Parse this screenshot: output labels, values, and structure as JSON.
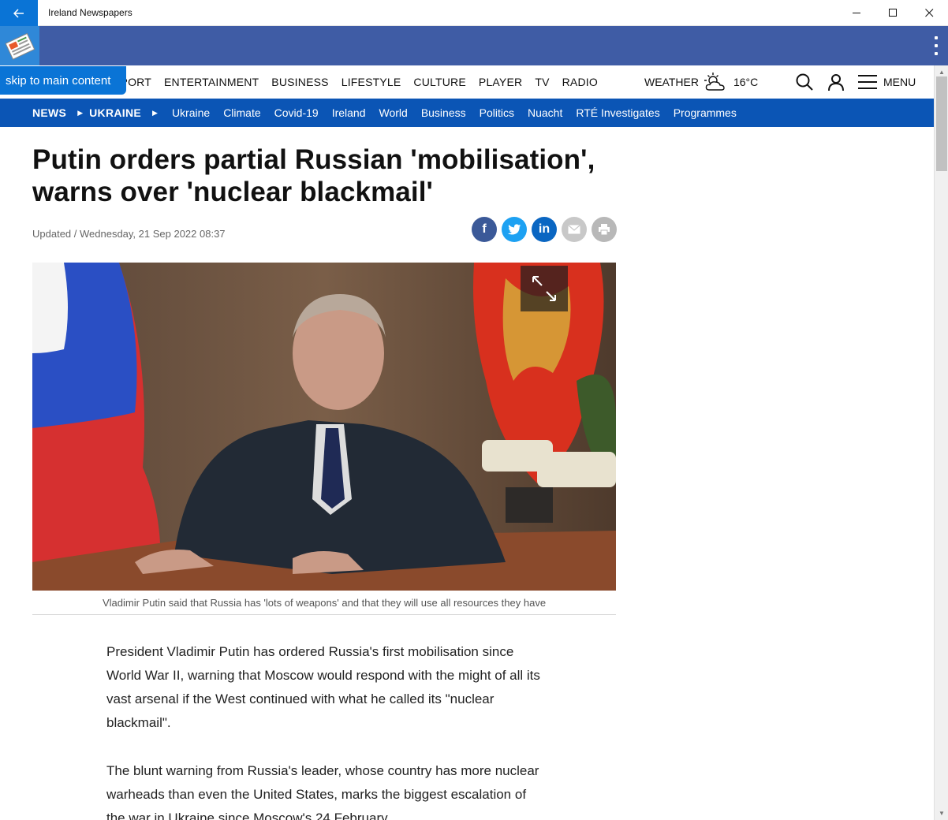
{
  "window": {
    "app_title": "Ireland Newspapers",
    "back_icon": "back-arrow-icon",
    "controls": [
      "minimize-icon",
      "maximize-icon",
      "close-icon"
    ]
  },
  "appbar": {
    "color": "#3f5ca5",
    "logo_icon": "newspaper-icon",
    "overflow_icon": "more-vertical-icon"
  },
  "skip_link": "skip to main content",
  "main_nav": {
    "items": [
      "SPORT",
      "ENTERTAINMENT",
      "BUSINESS",
      "LIFESTYLE",
      "CULTURE",
      "PLAYER",
      "TV",
      "RADIO"
    ],
    "weather_label": "WEATHER",
    "weather_icon": "partly-cloudy-icon",
    "temperature": "16°C",
    "menu_label": "MENU"
  },
  "sub_nav": {
    "color": "#0b55b5",
    "section": "NEWS",
    "topic": "UKRAINE",
    "items": [
      "Ukraine",
      "Climate",
      "Covid-19",
      "Ireland",
      "World",
      "Business",
      "Politics",
      "Nuacht",
      "RTÉ Investigates",
      "Programmes"
    ]
  },
  "article": {
    "headline_line1": "Putin orders partial Russian 'mobilisation',",
    "headline_line2": "warns over 'nuclear blackmail'",
    "dateline": "Updated / Wednesday, 21 Sep 2022 08:37",
    "share": [
      {
        "icon": "facebook-icon",
        "glyph": "f",
        "color": "#3b5998"
      },
      {
        "icon": "twitter-icon",
        "glyph": "🐦",
        "color": "#1da1f2"
      },
      {
        "icon": "linkedin-icon",
        "glyph": "in",
        "color": "#0a66c2"
      },
      {
        "icon": "email-icon",
        "glyph": "✉",
        "color": "#c8c8c8"
      },
      {
        "icon": "print-icon",
        "glyph": "⎙",
        "color": "#b8b8b8"
      }
    ],
    "image_caption": "Vladimir Putin said that Russia has 'lots of weapons' and that they will use all resources they have",
    "paragraphs": [
      "President Vladimir Putin has ordered Russia's first mobilisation since World War II, warning that Moscow would respond with the might of all its vast arsenal if the West continued with what he called its \"nuclear blackmail\".",
      "The blunt warning from Russia's leader, whose country has more nuclear warheads than even the United States, marks the biggest escalation of the war in Ukraine since Moscow's 24 February"
    ]
  }
}
